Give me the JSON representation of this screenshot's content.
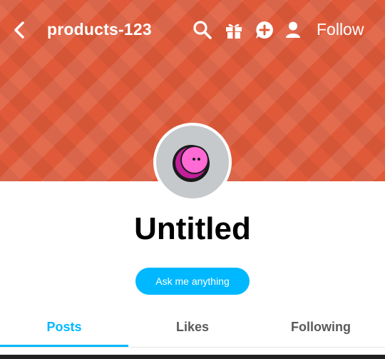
{
  "header": {
    "blog_name": "products-123",
    "follow_label": "Follow",
    "icons": [
      "back-icon",
      "search-icon",
      "gift-icon",
      "chat-plus-icon",
      "user-icon"
    ]
  },
  "banner": {
    "color": "#e05a3a"
  },
  "profile": {
    "title": "Untitled",
    "ask_label": "Ask me anything",
    "avatar_bg": "#c6c9cc",
    "avatar_face_color": "#ff6ad5"
  },
  "tabs": [
    {
      "label": "Posts",
      "active": true
    },
    {
      "label": "Likes",
      "active": false
    },
    {
      "label": "Following",
      "active": false
    }
  ],
  "accent_color": "#00b8ff"
}
